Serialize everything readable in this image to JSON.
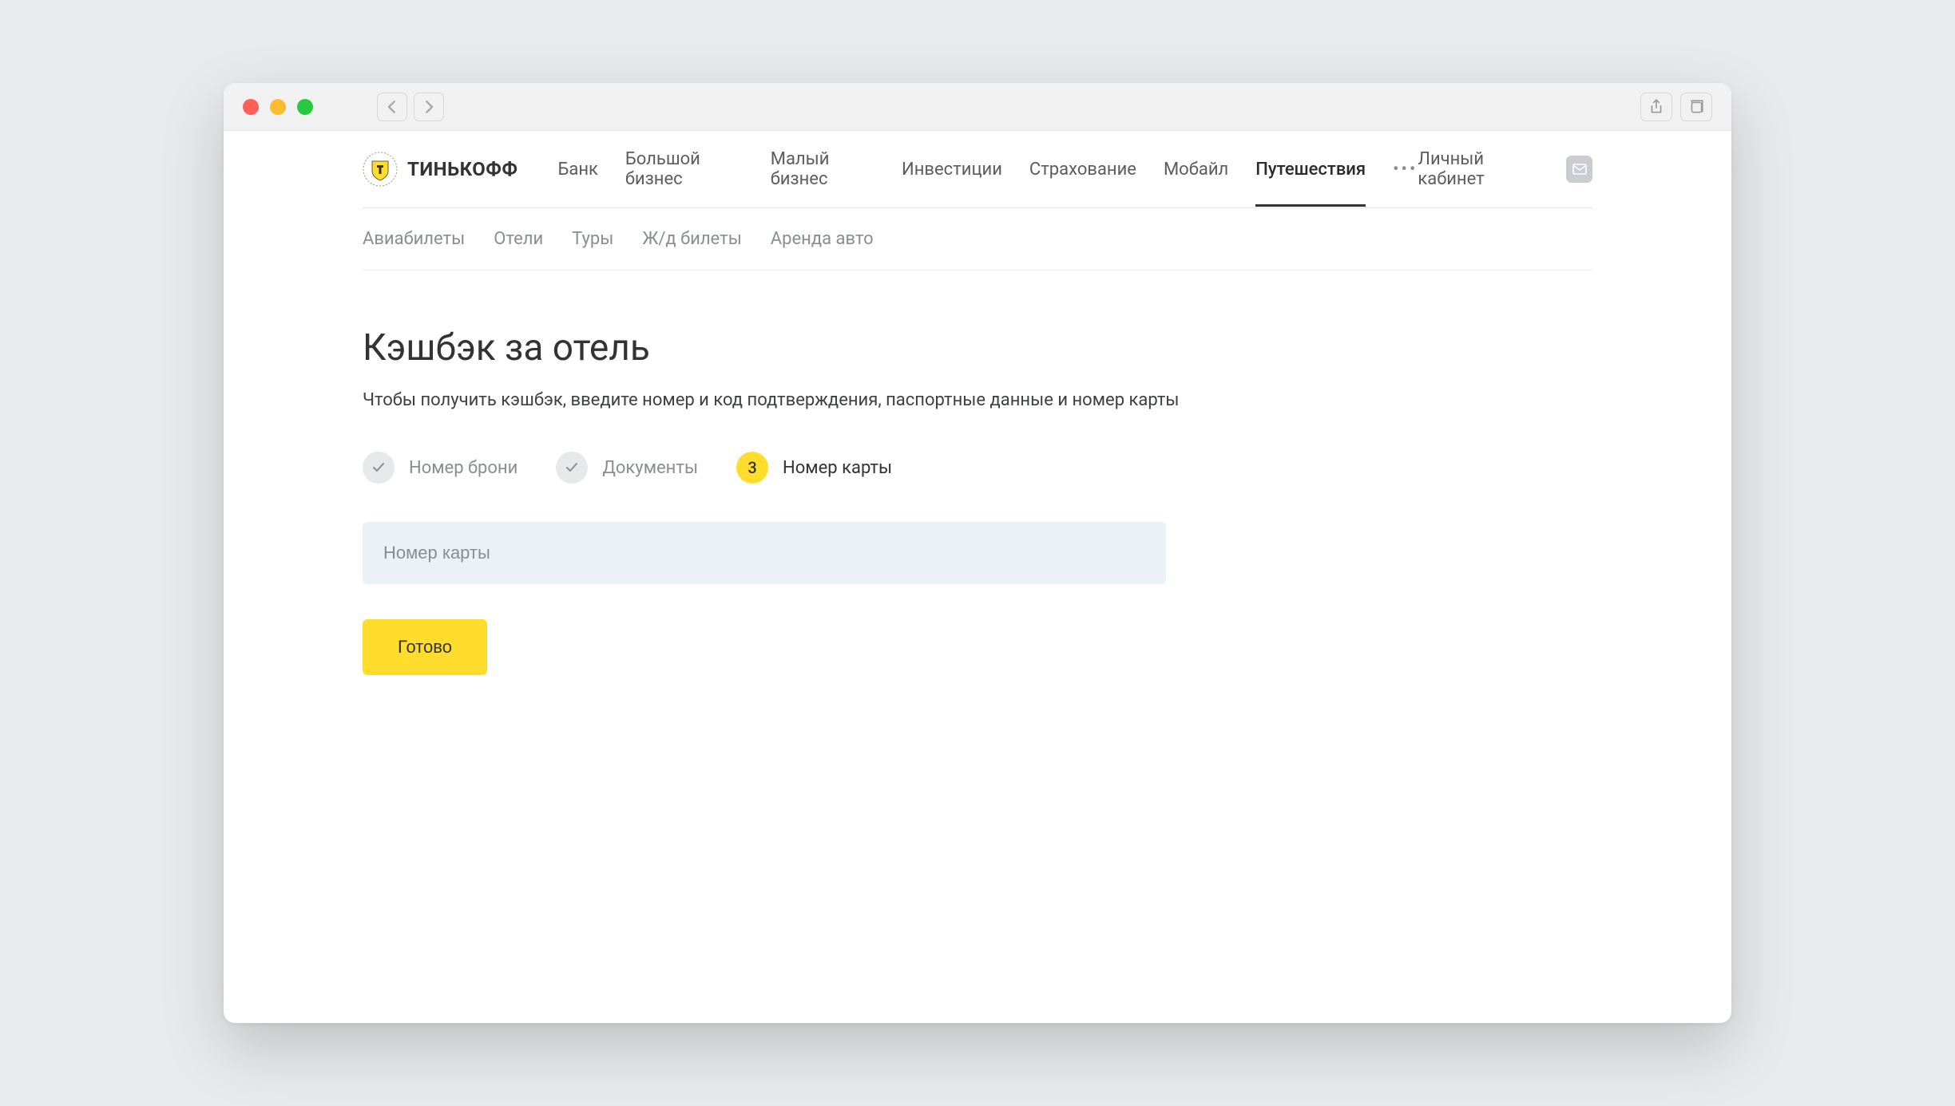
{
  "brand": {
    "name": "ТИНЬКОФФ"
  },
  "header": {
    "nav": [
      {
        "label": "Банк",
        "active": false
      },
      {
        "label": "Большой бизнес",
        "active": false
      },
      {
        "label": "Малый бизнес",
        "active": false
      },
      {
        "label": "Инвестиции",
        "active": false
      },
      {
        "label": "Страхование",
        "active": false
      },
      {
        "label": "Мобайл",
        "active": false
      },
      {
        "label": "Путешествия",
        "active": true
      }
    ],
    "cabinet": "Личный кабинет"
  },
  "subnav": [
    {
      "label": "Авиабилеты"
    },
    {
      "label": "Отели"
    },
    {
      "label": "Туры"
    },
    {
      "label": "Ж/д билеты"
    },
    {
      "label": "Аренда авто"
    }
  ],
  "page": {
    "title": "Кэшбэк за отель",
    "subtitle": "Чтобы получить кэшбэк, введите номер и код подтверждения, паспортные данные и номер карты"
  },
  "steps": [
    {
      "label": "Номер брони",
      "state": "done"
    },
    {
      "label": "Документы",
      "state": "done"
    },
    {
      "label": "Номер карты",
      "state": "active",
      "number": "3"
    }
  ],
  "form": {
    "card_placeholder": "Номер карты",
    "submit_label": "Готово"
  }
}
